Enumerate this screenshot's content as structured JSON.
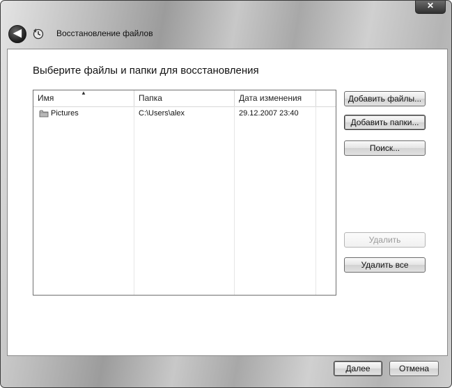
{
  "window": {
    "close_label": "✕",
    "back_label": "◀",
    "title": "Восстановление файлов"
  },
  "main": {
    "heading": "Выберите файлы и папки для восстановления"
  },
  "list": {
    "columns": {
      "name": "Имя",
      "folder": "Папка",
      "date": "Дата изменения"
    },
    "sort_indicator": "▲",
    "rows": [
      {
        "name": "Pictures",
        "folder": "C:\\Users\\alex",
        "date": "29.12.2007 23:40"
      }
    ]
  },
  "buttons": {
    "add_files": "Добавить файлы...",
    "add_folders": "Добавить папки...",
    "search": "Поиск...",
    "delete": "Удалить",
    "delete_all": "Удалить все",
    "next": "Далее",
    "cancel": "Отмена"
  },
  "icons": {
    "back": "back-arrow-icon",
    "app": "backup-restore-icon",
    "folder": "folder-icon",
    "close": "close-icon"
  },
  "colors": {
    "accent": "#2a2a2a",
    "content_bg": "#ffffff",
    "chrome": "#b0b0b0"
  }
}
